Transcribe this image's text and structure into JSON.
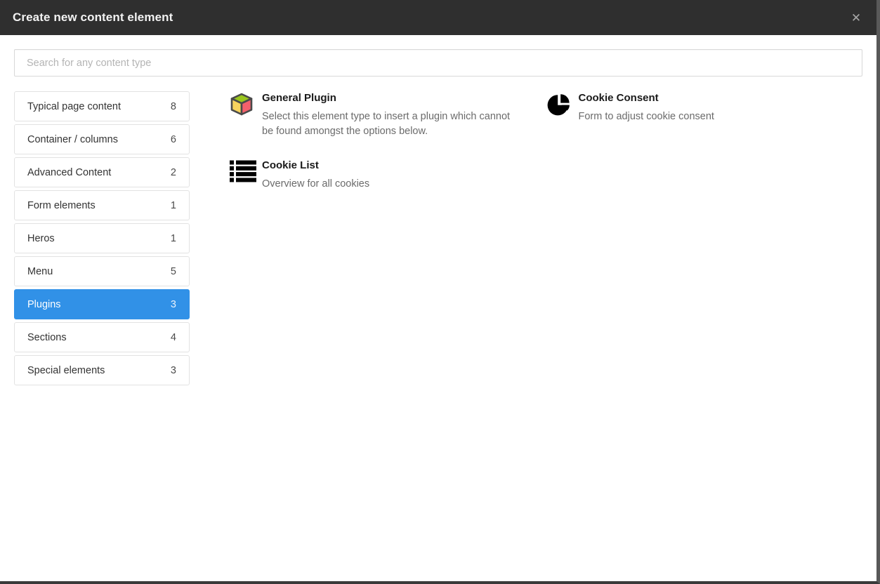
{
  "window": {
    "title": "Create new content element",
    "close_label": "✕",
    "close_icon": "close-icon",
    "accent_color": "#3191e7",
    "header_color": "#2f2f2f"
  },
  "search": {
    "placeholder": "Search for any content type",
    "value": ""
  },
  "categories": [
    {
      "label": "Typical page content",
      "count": "8",
      "active": false
    },
    {
      "label": "Container / columns",
      "count": "6",
      "active": false
    },
    {
      "label": "Advanced Content",
      "count": "2",
      "active": false
    },
    {
      "label": "Form elements",
      "count": "1",
      "active": false
    },
    {
      "label": "Heros",
      "count": "1",
      "active": false
    },
    {
      "label": "Menu",
      "count": "5",
      "active": false
    },
    {
      "label": "Plugins",
      "count": "3",
      "active": true
    },
    {
      "label": "Sections",
      "count": "4",
      "active": false
    },
    {
      "label": "Special elements",
      "count": "3",
      "active": false
    }
  ],
  "elements": [
    {
      "title": "General Plugin",
      "description": "Select this element type to insert a plugin which cannot be found amongst the options below.",
      "icon": "cube-icon",
      "icon_colors": {
        "top": "#9ac61e",
        "left": "#f7d35e",
        "right": "#f4606c",
        "outline": "#4a4a4a"
      }
    },
    {
      "title": "Cookie Consent",
      "description": "Form to adjust cookie consent",
      "icon": "pie-chart-icon",
      "icon_colors": {
        "fill": "#000000"
      }
    },
    {
      "title": "Cookie List",
      "description": "Overview for all cookies",
      "icon": "list-icon",
      "icon_colors": {
        "fill": "#000000"
      }
    }
  ]
}
